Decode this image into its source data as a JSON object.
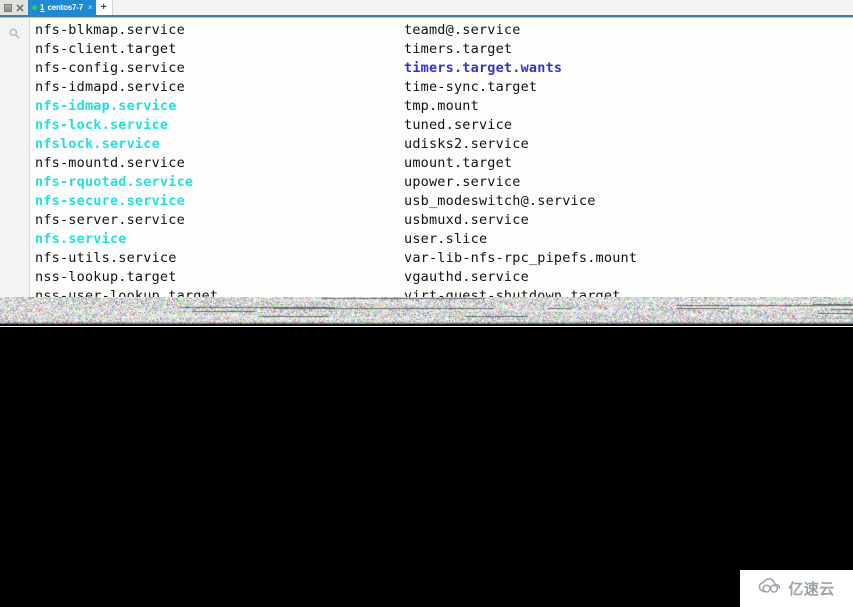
{
  "window": {
    "controls": [
      {
        "name": "pin-icon",
        "label": "pin"
      },
      {
        "name": "close-icon",
        "label": "close"
      }
    ]
  },
  "tabbar": {
    "tab": {
      "index": "1",
      "title": "centos7-7",
      "close_label": "×",
      "status_dot_color": "#27d04a"
    },
    "new_tab_label": "+"
  },
  "gutter": {
    "search_icon_name": "search-icon"
  },
  "colors": {
    "tab_active": "#1e8ad6",
    "terminal_background": "#fdfdfb",
    "text_default": "#111111",
    "text_cyan": "#22e0e0",
    "text_blue": "#3333cc",
    "tab_underline": "#3f7fb0",
    "watermark_text": "#9aa3ab"
  },
  "terminal": {
    "rows": [
      {
        "left": {
          "text": "nfs-blkmap.service",
          "color": "default"
        },
        "right": {
          "text": "teamd@.service",
          "color": "default"
        }
      },
      {
        "left": {
          "text": "nfs-client.target",
          "color": "default"
        },
        "right": {
          "text": "timers.target",
          "color": "default"
        }
      },
      {
        "left": {
          "text": "nfs-config.service",
          "color": "default"
        },
        "right": {
          "text": "timers.target.wants",
          "color": "blue"
        }
      },
      {
        "left": {
          "text": "nfs-idmapd.service",
          "color": "default"
        },
        "right": {
          "text": "time-sync.target",
          "color": "default"
        }
      },
      {
        "left": {
          "text": "nfs-idmap.service",
          "color": "cyan"
        },
        "right": {
          "text": "tmp.mount",
          "color": "default"
        }
      },
      {
        "left": {
          "text": "nfs-lock.service",
          "color": "cyan"
        },
        "right": {
          "text": "tuned.service",
          "color": "default"
        }
      },
      {
        "left": {
          "text": "nfslock.service",
          "color": "cyan"
        },
        "right": {
          "text": "udisks2.service",
          "color": "default"
        }
      },
      {
        "left": {
          "text": "nfs-mountd.service",
          "color": "default"
        },
        "right": {
          "text": "umount.target",
          "color": "default"
        }
      },
      {
        "left": {
          "text": "nfs-rquotad.service",
          "color": "cyan"
        },
        "right": {
          "text": "upower.service",
          "color": "default"
        }
      },
      {
        "left": {
          "text": "nfs-secure.service",
          "color": "cyan"
        },
        "right": {
          "text": "usb_modeswitch@.service",
          "color": "default"
        }
      },
      {
        "left": {
          "text": "nfs-server.service",
          "color": "default"
        },
        "right": {
          "text": "usbmuxd.service",
          "color": "default"
        }
      },
      {
        "left": {
          "text": "nfs.service",
          "color": "cyan"
        },
        "right": {
          "text": "user.slice",
          "color": "default"
        }
      },
      {
        "left": {
          "text": "nfs-utils.service",
          "color": "default"
        },
        "right": {
          "text": "var-lib-nfs-rpc_pipefs.mount",
          "color": "default"
        }
      },
      {
        "left": {
          "text": "nss-lookup.target",
          "color": "default"
        },
        "right": {
          "text": "vgauthd.service",
          "color": "default"
        }
      },
      {
        "left": {
          "text": "nss-user-lookup.target",
          "color": "default"
        },
        "right": {
          "text": "virt-guest-shutdown.target",
          "color": "default"
        }
      }
    ]
  },
  "watermark": {
    "text": "亿速云",
    "logo_name": "cloud-logo-icon"
  }
}
